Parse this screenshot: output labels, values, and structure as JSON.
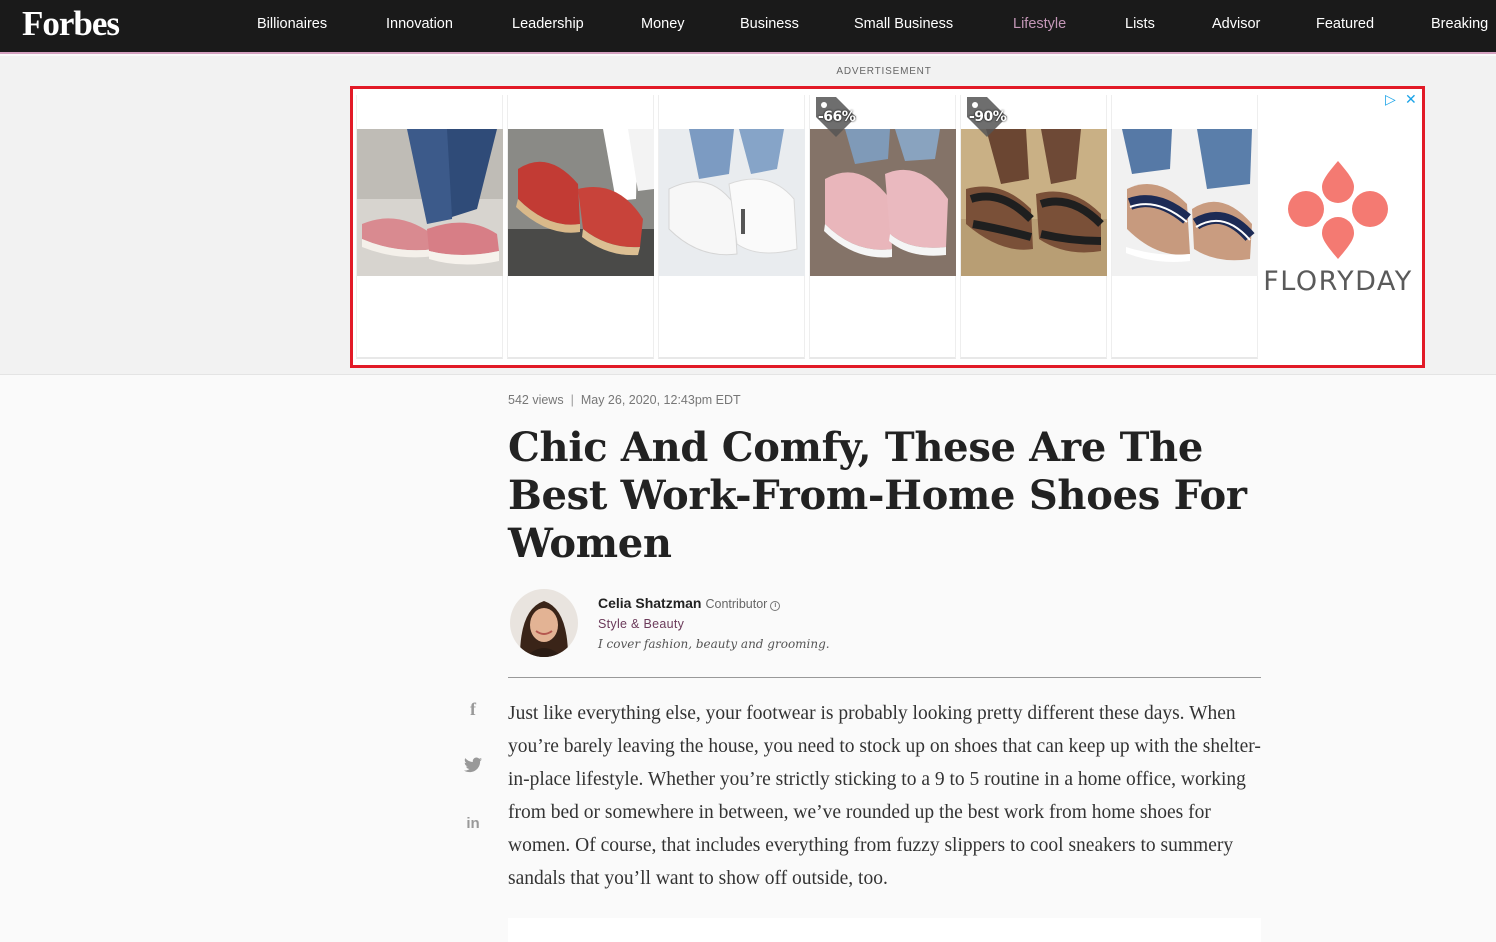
{
  "nav": {
    "logo": "Forbes",
    "items": [
      {
        "label": "Billionaires"
      },
      {
        "label": "Innovation"
      },
      {
        "label": "Leadership"
      },
      {
        "label": "Money"
      },
      {
        "label": "Business"
      },
      {
        "label": "Small Business"
      },
      {
        "label": "Lifestyle",
        "active": true
      },
      {
        "label": "Lists"
      },
      {
        "label": "Advisor"
      },
      {
        "label": "Featured"
      },
      {
        "label": "Breaking"
      }
    ]
  },
  "ad": {
    "label": "ADVERTISEMENT",
    "brand": "FLORYDAY",
    "brand_color": "#f47a72",
    "border_color": "#e21a27",
    "discounts": [
      "-66%",
      "-90%"
    ],
    "adchoices_icon": "adchoices-icon",
    "close_icon": "close-icon"
  },
  "article": {
    "views": "542 views",
    "separator": "|",
    "date": "May 26, 2020, 12:43pm EDT",
    "headline": "Chic And Comfy, These Are The Best Work-From-Home Shoes For Women",
    "author": {
      "name": "Celia Shatzman",
      "role": "Contributor",
      "info_icon": "i",
      "section": "Style & Beauty",
      "bio": "I cover fashion, beauty and grooming."
    },
    "share": {
      "facebook": "f",
      "twitter": "twitter-icon",
      "linkedin": "in"
    },
    "body": "Just like everything else, your footwear is probably looking pretty different these days. When you’re barely leaving the house, you need to stock up on shoes that can keep up with the shelter-in-place lifestyle. Whether you’re strictly sticking to a 9 to 5 routine in a home office, working from bed or somewhere in between, we’ve rounded up the best work from home shoes for women. Of course, that includes everything from fuzzy slippers to cool sneakers to summery sandals that you’ll want to show off outside, too."
  }
}
